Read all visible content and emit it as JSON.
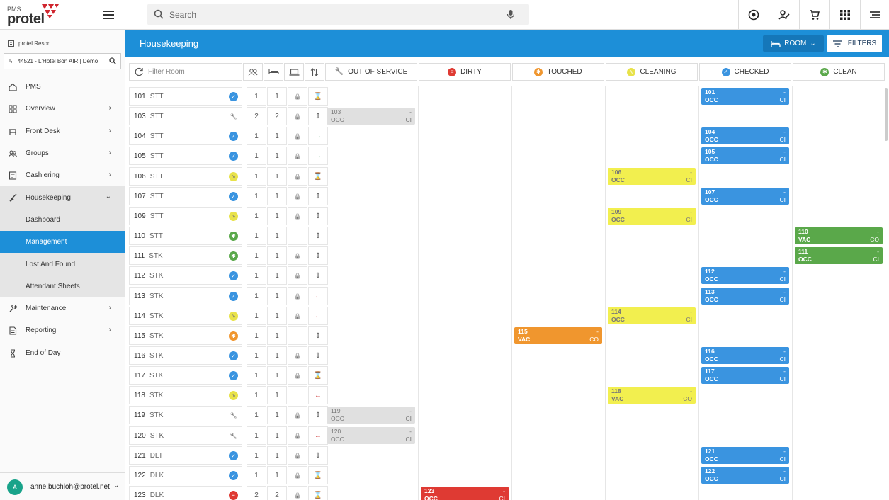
{
  "app": {
    "pms_label": "PMS",
    "brand": "protel"
  },
  "topbar": {
    "search_placeholder": "Search"
  },
  "sidebar": {
    "property": "protel Resort",
    "hotel": "44521 - L'Hotel  Bon AIR | Demo",
    "items": [
      {
        "label": "PMS",
        "icon": "home-icon",
        "chevron": false
      },
      {
        "label": "Overview",
        "icon": "grid-icon",
        "chevron": true
      },
      {
        "label": "Front Desk",
        "icon": "desk-icon",
        "chevron": true
      },
      {
        "label": "Groups",
        "icon": "group-icon",
        "chevron": true
      },
      {
        "label": "Cashiering",
        "icon": "register-icon",
        "chevron": true
      },
      {
        "label": "Housekeeping",
        "icon": "broom-icon",
        "chevron": true,
        "open": true
      }
    ],
    "sub_items": [
      {
        "label": "Dashboard"
      },
      {
        "label": "Management",
        "active": true
      },
      {
        "label": "Lost And Found"
      },
      {
        "label": "Attendant Sheets"
      }
    ],
    "items_after": [
      {
        "label": "Maintenance",
        "icon": "wrench-icon",
        "chevron": true
      },
      {
        "label": "Reporting",
        "icon": "report-icon",
        "chevron": true
      },
      {
        "label": "End of Day",
        "icon": "hourglass-icon",
        "chevron": false
      }
    ],
    "user": {
      "initial": "A",
      "email": "anne.buchloh@protel.net"
    }
  },
  "header": {
    "title": "Housekeeping",
    "room_button": "ROOM",
    "filters_button": "FILTERS"
  },
  "filter": {
    "placeholder": "Filter Room"
  },
  "columns": [
    {
      "label": "OUT OF SERVICE",
      "color": "#9e9e9e",
      "icon": "wrench-icon"
    },
    {
      "label": "DIRTY",
      "color": "#df3a33",
      "icon": "dirty-icon"
    },
    {
      "label": "TOUCHED",
      "color": "#f0962e",
      "icon": "touched-icon"
    },
    {
      "label": "CLEANING",
      "color": "#e8e24a",
      "icon": "cleaning-icon"
    },
    {
      "label": "CHECKED",
      "color": "#3a94e0",
      "icon": "check-icon"
    },
    {
      "label": "CLEAN",
      "color": "#5aa84a",
      "icon": "clean-icon"
    }
  ],
  "rooms": [
    {
      "no": "101",
      "type": "STT",
      "status": "checked",
      "a": "1",
      "b": "1",
      "lock": true,
      "move": "hourglass",
      "col": 4,
      "occ": "OCC",
      "code": "CI"
    },
    {
      "no": "103",
      "type": "STT",
      "status": "oos",
      "a": "2",
      "b": "2",
      "lock": true,
      "move": "updown",
      "col": 0,
      "occ": "OCC",
      "code": "CI"
    },
    {
      "no": "104",
      "type": "STT",
      "status": "checked",
      "a": "1",
      "b": "1",
      "lock": true,
      "move": "right",
      "col": 4,
      "occ": "OCC",
      "code": "CI"
    },
    {
      "no": "105",
      "type": "STT",
      "status": "checked",
      "a": "1",
      "b": "1",
      "lock": true,
      "move": "right",
      "col": 4,
      "occ": "OCC",
      "code": "CI"
    },
    {
      "no": "106",
      "type": "STT",
      "status": "cleaning",
      "a": "1",
      "b": "1",
      "lock": true,
      "move": "hourglass",
      "col": 3,
      "occ": "OCC",
      "code": "CI"
    },
    {
      "no": "107",
      "type": "STT",
      "status": "checked",
      "a": "1",
      "b": "1",
      "lock": true,
      "move": "updown",
      "col": 4,
      "occ": "OCC",
      "code": "CI"
    },
    {
      "no": "109",
      "type": "STT",
      "status": "cleaning",
      "a": "1",
      "b": "1",
      "lock": true,
      "move": "updown",
      "col": 3,
      "occ": "OCC",
      "code": "CI"
    },
    {
      "no": "110",
      "type": "STT",
      "status": "clean",
      "a": "1",
      "b": "1",
      "lock": false,
      "move": "updown",
      "col": 5,
      "occ": "VAC",
      "code": "CO"
    },
    {
      "no": "111",
      "type": "STK",
      "status": "clean",
      "a": "1",
      "b": "1",
      "lock": true,
      "move": "updown",
      "col": 5,
      "occ": "OCC",
      "code": "CI"
    },
    {
      "no": "112",
      "type": "STK",
      "status": "checked",
      "a": "1",
      "b": "1",
      "lock": true,
      "move": "updown",
      "col": 4,
      "occ": "OCC",
      "code": "CI"
    },
    {
      "no": "113",
      "type": "STK",
      "status": "checked",
      "a": "1",
      "b": "1",
      "lock": true,
      "move": "left",
      "col": 4,
      "occ": "OCC",
      "code": "CI"
    },
    {
      "no": "114",
      "type": "STK",
      "status": "cleaning",
      "a": "1",
      "b": "1",
      "lock": true,
      "move": "left",
      "col": 3,
      "occ": "OCC",
      "code": "CI"
    },
    {
      "no": "115",
      "type": "STK",
      "status": "touched",
      "a": "1",
      "b": "1",
      "lock": false,
      "move": "updown",
      "col": 2,
      "occ": "VAC",
      "code": "CO"
    },
    {
      "no": "116",
      "type": "STK",
      "status": "checked",
      "a": "1",
      "b": "1",
      "lock": true,
      "move": "updown",
      "col": 4,
      "occ": "OCC",
      "code": "CI"
    },
    {
      "no": "117",
      "type": "STK",
      "status": "checked",
      "a": "1",
      "b": "1",
      "lock": true,
      "move": "hourglass",
      "col": 4,
      "occ": "OCC",
      "code": "CI"
    },
    {
      "no": "118",
      "type": "STK",
      "status": "cleaning",
      "a": "1",
      "b": "1",
      "lock": false,
      "move": "left",
      "col": 3,
      "occ": "VAC",
      "code": "CO"
    },
    {
      "no": "119",
      "type": "STK",
      "status": "oos",
      "a": "1",
      "b": "1",
      "lock": true,
      "move": "updown",
      "col": 0,
      "occ": "OCC",
      "code": "CI"
    },
    {
      "no": "120",
      "type": "STK",
      "status": "oos",
      "a": "1",
      "b": "1",
      "lock": true,
      "move": "left",
      "col": 0,
      "occ": "OCC",
      "code": "CI"
    },
    {
      "no": "121",
      "type": "DLT",
      "status": "checked",
      "a": "1",
      "b": "1",
      "lock": true,
      "move": "updown",
      "col": 4,
      "occ": "OCC",
      "code": "CI"
    },
    {
      "no": "122",
      "type": "DLK",
      "status": "checked",
      "a": "1",
      "b": "1",
      "lock": true,
      "move": "hourglass",
      "col": 4,
      "occ": "OCC",
      "code": "CI"
    },
    {
      "no": "123",
      "type": "DLK",
      "status": "dirty",
      "a": "2",
      "b": "2",
      "lock": true,
      "move": "hourglass",
      "col": 1,
      "occ": "OCC",
      "code": "CI"
    }
  ],
  "card_dash": "-"
}
